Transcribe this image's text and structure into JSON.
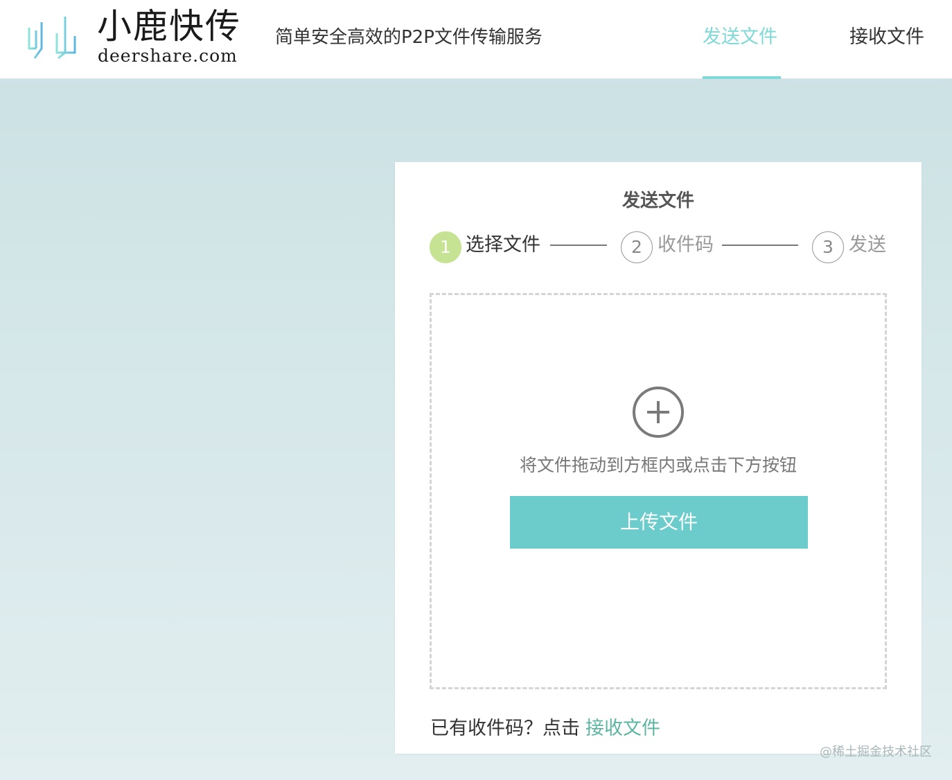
{
  "header": {
    "logo_cn": "小鹿快传",
    "logo_en": "deershare.com",
    "slogan": "简单安全高效的P2P文件传输服务",
    "nav": [
      {
        "label": "发送文件",
        "active": true
      },
      {
        "label": "接收文件",
        "active": false
      }
    ]
  },
  "card": {
    "title": "发送文件",
    "steps": [
      {
        "number": "1",
        "label": "选择文件",
        "active": true
      },
      {
        "number": "2",
        "label": "收件码",
        "active": false
      },
      {
        "number": "3",
        "label": "发送",
        "active": false
      }
    ],
    "dropzone": {
      "icon": "plus-circle-icon",
      "hint": "将文件拖动到方框内或点击下方按钮",
      "button_label": "上传文件"
    },
    "footer": {
      "prompt": "已有收件码？点击",
      "link_label": "接收文件"
    }
  },
  "watermark": "@稀土掘金技术社区",
  "colors": {
    "accent": "#7fd9d6",
    "button": "#6ccbcb",
    "step_active": "#c6e293",
    "link": "#5db6a2"
  }
}
